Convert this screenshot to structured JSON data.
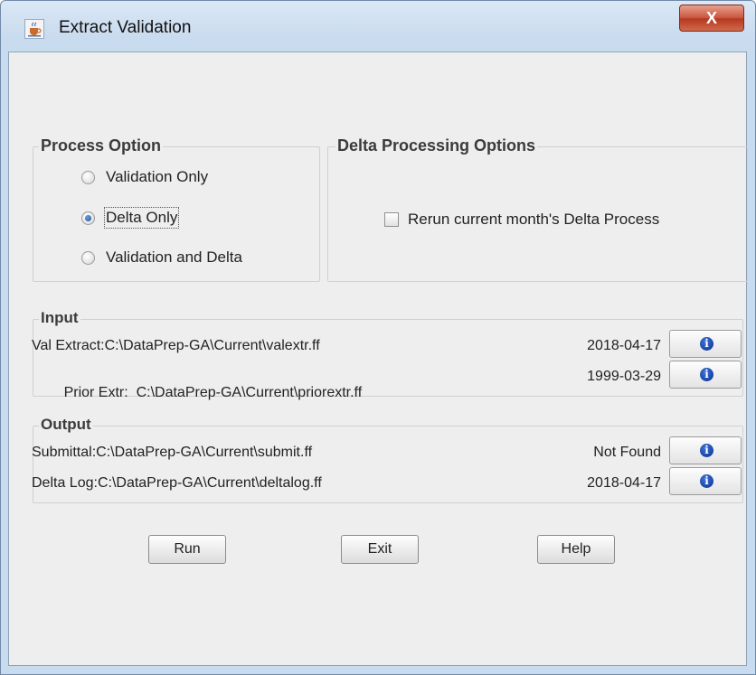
{
  "window": {
    "title": "Extract Validation",
    "close_label": "X"
  },
  "process_option": {
    "title": "Process Option",
    "options": [
      {
        "label": "Validation Only",
        "selected": false
      },
      {
        "label": "Delta Only",
        "selected": true
      },
      {
        "label": "Validation and Delta",
        "selected": false
      }
    ]
  },
  "delta_options": {
    "title": "Delta Processing Options",
    "rerun_label": "Rerun current month's Delta Process",
    "rerun_checked": false
  },
  "input": {
    "title": "Input",
    "rows": [
      {
        "label": "Val Extract:",
        "path": "C:\\DataPrep-GA\\Current\\valextr.ff",
        "date": "2018-04-17"
      },
      {
        "label": "Prior Extr:  ",
        "path": "C:\\DataPrep-GA\\Current\\priorextr.ff",
        "date": "1999-03-29"
      }
    ]
  },
  "output": {
    "title": "Output",
    "rows": [
      {
        "label": "Submittal:",
        "path": "C:\\DataPrep-GA\\Current\\submit.ff",
        "date": "Not Found"
      },
      {
        "label": "Delta Log:",
        "path": "C:\\DataPrep-GA\\Current\\deltalog.ff",
        "date": "2018-04-17"
      }
    ]
  },
  "buttons": {
    "run": "Run",
    "exit": "Exit",
    "help": "Help"
  },
  "icons": {
    "app": "java-cup-icon",
    "info": "info-icon"
  }
}
